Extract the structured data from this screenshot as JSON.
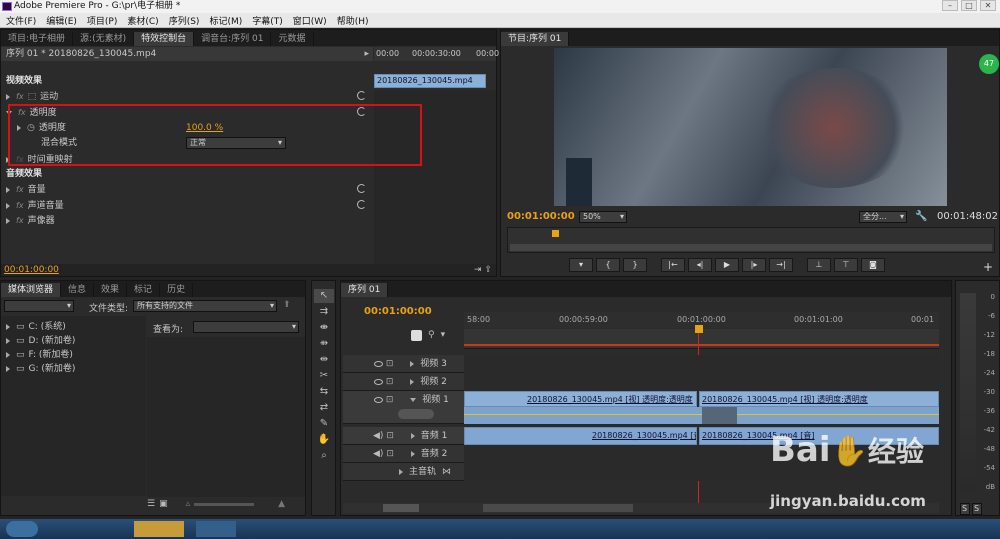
{
  "window": {
    "title": "Adobe Premiere Pro - G:\\pr\\电子相册 *"
  },
  "menu": [
    "文件(F)",
    "编辑(E)",
    "项目(P)",
    "素材(C)",
    "序列(S)",
    "标记(M)",
    "字幕(T)",
    "窗口(W)",
    "帮助(H)"
  ],
  "source_panel": {
    "tabs": [
      "项目:电子相册",
      "源:(无素材)",
      "特效控制台",
      "调音台:序列 01",
      "元数据"
    ],
    "sequence_label": "序列 01 * 20180826_130045.mp4",
    "time_ruler": [
      "00:00",
      "00:00:30:00",
      "00:00"
    ],
    "mini_clip": "20180826_130045.mp4",
    "video_effects": "视频效果",
    "motion": "运动",
    "opacity": "透明度",
    "opacity_param": "透明度",
    "opacity_value": "100.0 %",
    "blend_mode_label": "混合模式",
    "blend_mode_value": "正常",
    "time_remap": "时间重映射",
    "audio_effects": "音频效果",
    "volume": "音量",
    "channel_volume": "声道音量",
    "panner": "声像器",
    "current_time": "00:01:00:00"
  },
  "program_monitor": {
    "tab": "节目:序列 01",
    "timecode": "00:01:00:00",
    "zoom": "50%",
    "quality": "全分...",
    "duration": "00:01:48:02",
    "badge": "47"
  },
  "media_browser": {
    "tabs": [
      "媒体浏览器",
      "信息",
      "效果",
      "标记",
      "历史"
    ],
    "file_type_label": "文件类型:",
    "file_type_value": "所有支持的文件",
    "view_as_label": "查看为:",
    "drives": [
      "C: (系统)",
      "D: (新加卷)",
      "F: (新加卷)",
      "G: (新加卷)"
    ]
  },
  "timeline": {
    "tab": "序列 01",
    "timecode": "00:01:00:00",
    "ruler": [
      "58:00",
      "00:00:59:00",
      "00:01:00:00",
      "00:01:01:00",
      "00:01"
    ],
    "tracks": [
      "视频 3",
      "视频 2",
      "视频 1",
      "音频 1",
      "音频 2",
      "主音轨"
    ],
    "clips": {
      "v1_left": "20180826_130045.mp4 [视] 透明度:透明度",
      "v1_right": "20180826_130045.mp4 [视] 透明度:透明度",
      "a1_left": "20180826_130045.mp4 [音]",
      "a1_right": "20180826_130045.mp4 [音]"
    }
  },
  "audio_meter": {
    "labels": [
      "0",
      "-6",
      "-12",
      "-18",
      "-24",
      "-30",
      "-36",
      "-42",
      "-48",
      "-54",
      "dB"
    ],
    "buttons": [
      "S",
      "S"
    ]
  },
  "watermark": {
    "brand": "Bai",
    "brand2": "经验",
    "url": "jingyan.baidu.com"
  }
}
